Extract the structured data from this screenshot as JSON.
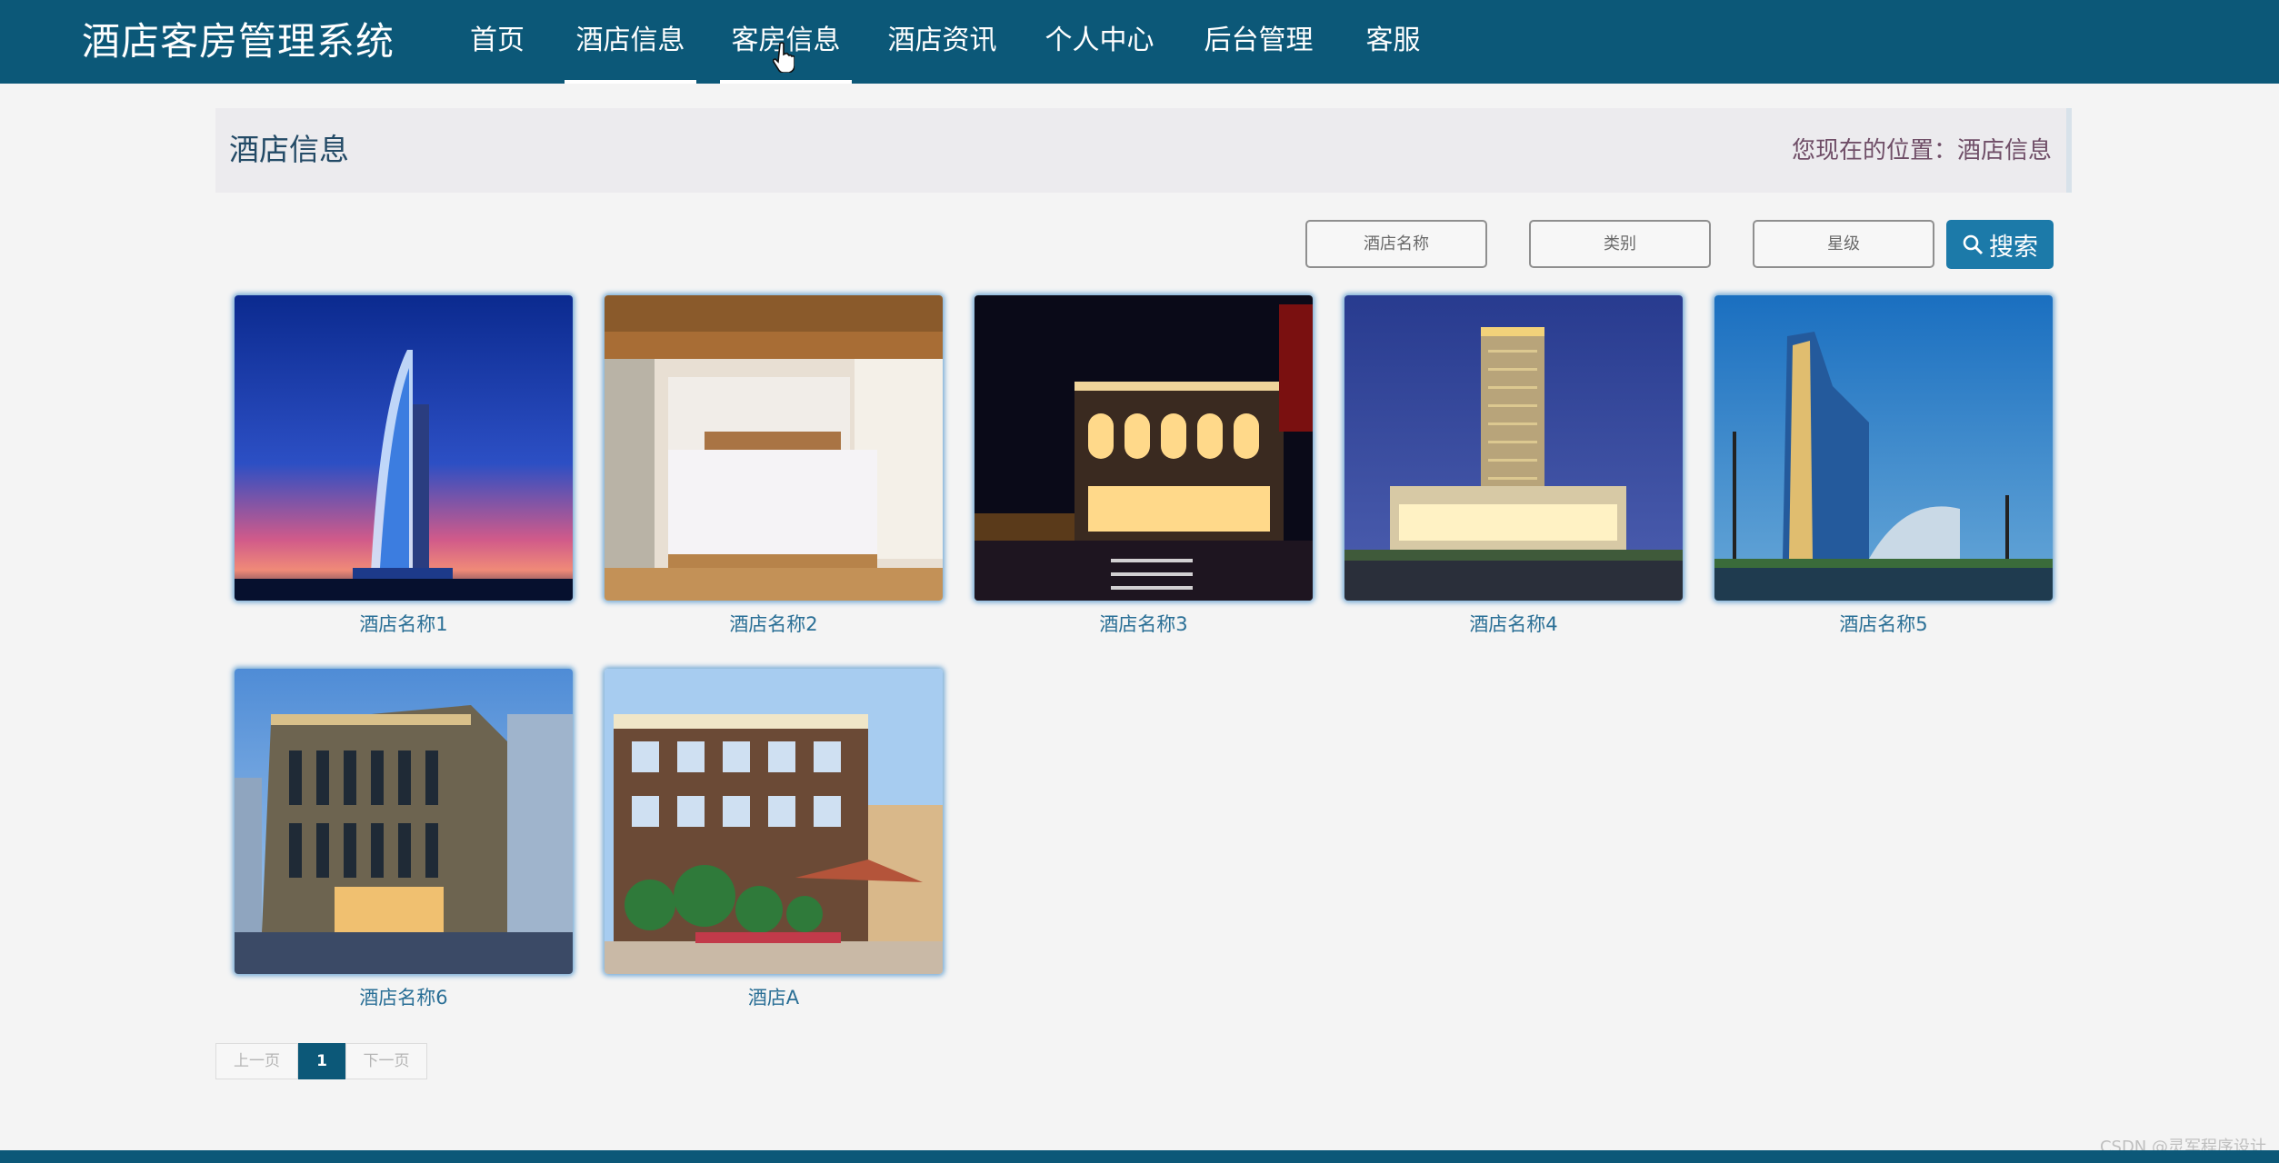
{
  "app": {
    "title": "酒店客房管理系统"
  },
  "nav": {
    "items": [
      {
        "label": "首页"
      },
      {
        "label": "酒店信息"
      },
      {
        "label": "客房信息"
      },
      {
        "label": "酒店资讯"
      },
      {
        "label": "个人中心"
      },
      {
        "label": "后台管理"
      },
      {
        "label": "客服"
      }
    ]
  },
  "header": {
    "title": "酒店信息",
    "location": "您现在的位置：酒店信息"
  },
  "search": {
    "name_placeholder": "酒店名称",
    "category_placeholder": "类别",
    "star_placeholder": "星级",
    "button_label": "搜索",
    "button_icon": "search-icon"
  },
  "hotels": [
    {
      "name": "酒店名称1"
    },
    {
      "name": "酒店名称2"
    },
    {
      "name": "酒店名称3"
    },
    {
      "name": "酒店名称4"
    },
    {
      "name": "酒店名称5"
    },
    {
      "name": "酒店名称6"
    },
    {
      "name": "酒店A"
    }
  ],
  "pagination": {
    "prev_label": "上一页",
    "current_page": "1",
    "next_label": "下一页"
  },
  "footer": {
    "watermark": "CSDN @灵军程序设计"
  },
  "colors": {
    "nav_bg": "#0c5878",
    "accent": "#1c7aa9",
    "link": "#2a6f96"
  }
}
